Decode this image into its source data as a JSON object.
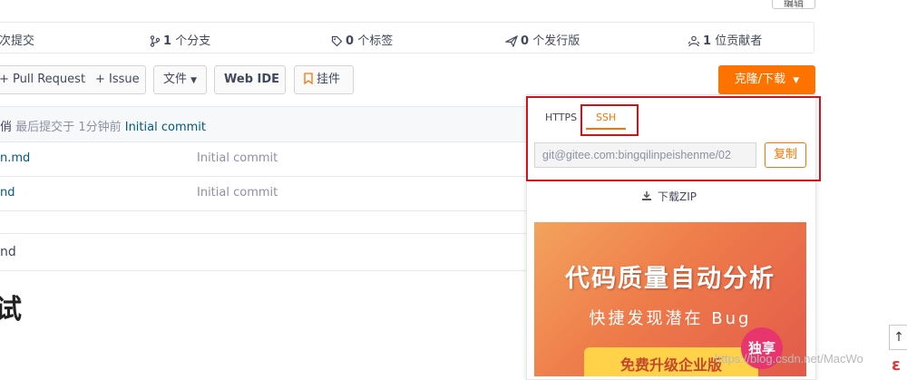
{
  "top_button": "编辑",
  "stats": {
    "commits": "次提交",
    "branches_num": "1",
    "branches_label": "个分支",
    "tags_num": "0",
    "tags_label": "个标签",
    "releases_num": "0",
    "releases_label": "个发行版",
    "contributors_num": "1",
    "contributors_label": "位贡献者"
  },
  "toolbar": {
    "pull_request": "+ Pull Request",
    "issue": "+ Issue",
    "files": "文件",
    "web_ide": "Web IDE",
    "widget": "挂件",
    "clone": "克隆/下载"
  },
  "commit_bar": {
    "prefix": "俏",
    "text": "最后提交于",
    "time": "1分钟前",
    "message": "Initial commit"
  },
  "files": [
    {
      "name": "n.md",
      "commit": "Initial commit"
    },
    {
      "name": "nd",
      "commit": "Initial commit"
    }
  ],
  "readme": {
    "filename": "nd",
    "heading": "试"
  },
  "clone_panel": {
    "tabs": [
      "HTTPS",
      "SSH"
    ],
    "active_tab": "SSH",
    "url": "git@gitee.com:bingqilinpeishenme/02",
    "copy": "复制",
    "download_zip": "下载ZIP"
  },
  "banner": {
    "title": "代码质量自动分析",
    "subtitle": "快捷发现潜在 Bug",
    "badge": "独享",
    "button": "免费升级企业版"
  },
  "watermark": "https://blog.csdn.net/MacWo",
  "colors": {
    "accent": "#fe7300",
    "highlight": "#d0121b",
    "link": "#005980"
  }
}
